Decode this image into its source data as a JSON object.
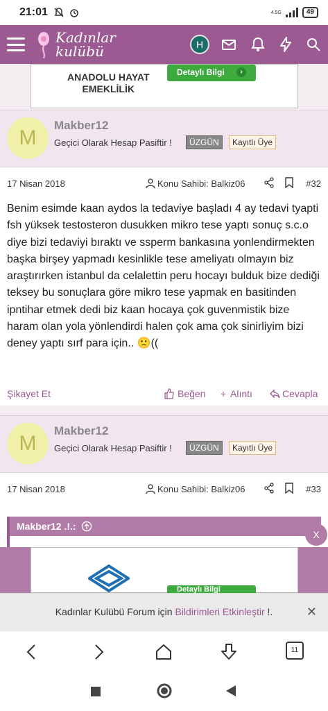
{
  "status_bar": {
    "time": "21:01",
    "network": "4.5G",
    "battery": "49"
  },
  "header": {
    "logo_line1": "Kadınlar",
    "logo_line2": "kulübü",
    "avatar_letter": "H"
  },
  "ad_top": {
    "brand_line1": "ANADOLU HAYAT",
    "brand_line2": "EMEKLİLİK",
    "button": "Detaylı Bilgi"
  },
  "posts": [
    {
      "avatar_letter": "M",
      "username": "Makber12",
      "user_title": "Geçici Olarak Hesap Pasiftir !",
      "badge_mood": "ÜZGÜN",
      "badge_role": "Kayıtlı Üye",
      "date": "17 Nisan 2018",
      "owner": "Konu Sahibi: Balkiz06",
      "number": "#32",
      "message": "Benim esimde kaan aydos la tedaviye başladı 4 ay tedavi tyapti fsh yüksek testosteron dusukken mikro tese yaptı sonuç s.c.o diye bizi tedaviyi bıraktı ve ssperm bankasına yonlendirmekten başka birşey yapmadı kesinlikle tese ameliyatı olmayın biz araştırırken istanbul da celalettin peru hocayı bulduk bize dediği teksey bu sonuçlara göre mikro tese yapmak en basitinden ipntihar etmek dedi biz kaan hocaya çok guvenmistik bize haram olan yola yönlendirdi halen çok ama çok sinirliyim bizi deney yaptı sırf para için.. 🙁((",
      "actions": {
        "report": "Şikayet Et",
        "like": "Beğen",
        "quote": "Alıntı",
        "reply": "Cevapla"
      }
    },
    {
      "avatar_letter": "M",
      "username": "Makber12",
      "user_title": "Geçici Olarak Hesap Pasiftir !",
      "badge_mood": "ÜZGÜN",
      "badge_role": "Kayıtlı Üye",
      "date": "17 Nisan 2018",
      "owner": "Konu Sahibi: Balkiz06",
      "number": "#33",
      "quote_author": "Makber12 .!.:"
    }
  ],
  "ad_bottom": {
    "button": "Detaylı Bilgi",
    "close": "X"
  },
  "notification": {
    "prefix": "Kadınlar Kulübü Forum için",
    "link": "Bildirimleri Etkinleştir",
    "suffix": "!.",
    "close": "✕"
  },
  "browser_nav": {
    "tabs_count": "11"
  },
  "colors": {
    "brand": "#9c5a92",
    "light_purple": "#f1e6f0",
    "ad_green": "#3caa3c"
  }
}
